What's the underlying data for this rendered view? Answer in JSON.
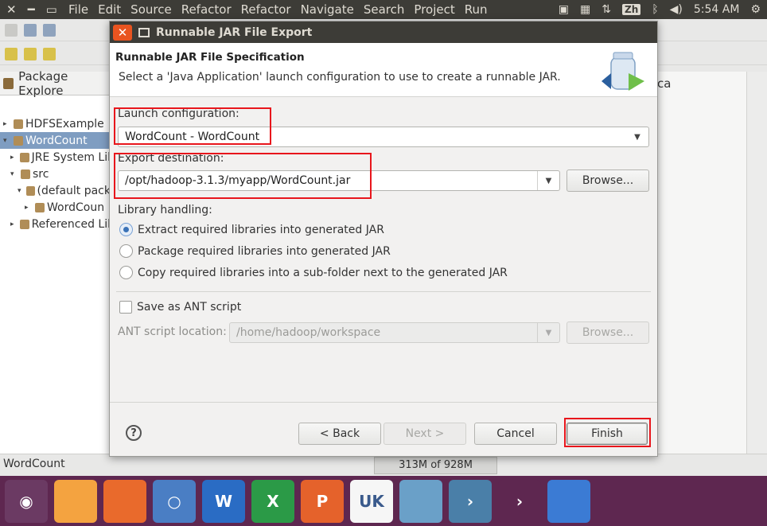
{
  "topbar": {
    "menu": [
      "File",
      "Edit",
      "Source",
      "Refactor",
      "Refactor",
      "Navigate",
      "Search",
      "Project",
      "Run"
    ],
    "input_method": "Zh",
    "time": "5:54 AM"
  },
  "package_explorer": {
    "tab_label": "Package Explore",
    "tree": [
      {
        "label": "HDFSExample",
        "indent": 0,
        "arrow": "▸",
        "selected": false
      },
      {
        "label": "WordCount",
        "indent": 0,
        "arrow": "▾",
        "selected": true
      },
      {
        "label": "JRE System Lil",
        "indent": 1,
        "arrow": "▸",
        "selected": false
      },
      {
        "label": "src",
        "indent": 1,
        "arrow": "▾",
        "selected": false
      },
      {
        "label": "(default pack",
        "indent": 2,
        "arrow": "▾",
        "selected": false
      },
      {
        "label": "WordCoun",
        "indent": 3,
        "arrow": "▸",
        "selected": false
      },
      {
        "label": "Referenced Lil",
        "indent": 1,
        "arrow": "▸",
        "selected": false
      }
    ]
  },
  "right_panel": {
    "tab_fragment": "ca"
  },
  "status": {
    "selection": "WordCount",
    "heap": "313M of 928M"
  },
  "dialog": {
    "title": "Runnable JAR File Export",
    "header_title": "Runnable JAR File Specification",
    "header_desc": "Select a 'Java Application' launch configuration to use to create a runnable JAR.",
    "launch_label": "Launch configuration:",
    "launch_value": "WordCount - WordCount",
    "export_label": "Export destination:",
    "export_value": "/opt/hadoop-3.1.3/myapp/WordCount.jar",
    "browse_label": "Browse...",
    "library_label": "Library handling:",
    "library_options": [
      {
        "label": "Extract required libraries into generated JAR",
        "checked": true
      },
      {
        "label": "Package required libraries into generated JAR",
        "checked": false
      },
      {
        "label": "Copy required libraries into a sub-folder next to the generated JAR",
        "checked": false
      }
    ],
    "ant_checkbox_label": "Save as ANT script",
    "ant_location_label": "ANT script location:",
    "ant_location_value": "/home/hadoop/workspace",
    "ant_browse_label": "Browse...",
    "buttons": {
      "help": "?",
      "back": "< Back",
      "next": "Next >",
      "cancel": "Cancel",
      "finish": "Finish"
    }
  },
  "dock": {
    "items": [
      {
        "name": "ubuntu-home",
        "color": "#6b3a63",
        "glyph": "◉"
      },
      {
        "name": "files",
        "color": "#f4a340",
        "glyph": ""
      },
      {
        "name": "firefox",
        "color": "#e96a2c",
        "glyph": ""
      },
      {
        "name": "chromium",
        "color": "#4a7ec4",
        "glyph": "○"
      },
      {
        "name": "writer",
        "color": "#2a6cc4",
        "glyph": "W"
      },
      {
        "name": "calc",
        "color": "#2b9a47",
        "glyph": "X"
      },
      {
        "name": "impress",
        "color": "#e5622b",
        "glyph": "P"
      },
      {
        "name": "software",
        "color": "#f6f6f6",
        "glyph": "UK"
      },
      {
        "name": "rhythmbox",
        "color": "#6aa0c8",
        "glyph": ""
      },
      {
        "name": "eclipse",
        "color": "#4a7fa8",
        "glyph": "›"
      },
      {
        "name": "terminal",
        "color": "#5e2750",
        "glyph": "›"
      },
      {
        "name": "workspaces",
        "color": "#3b7bd4",
        "glyph": ""
      }
    ]
  }
}
